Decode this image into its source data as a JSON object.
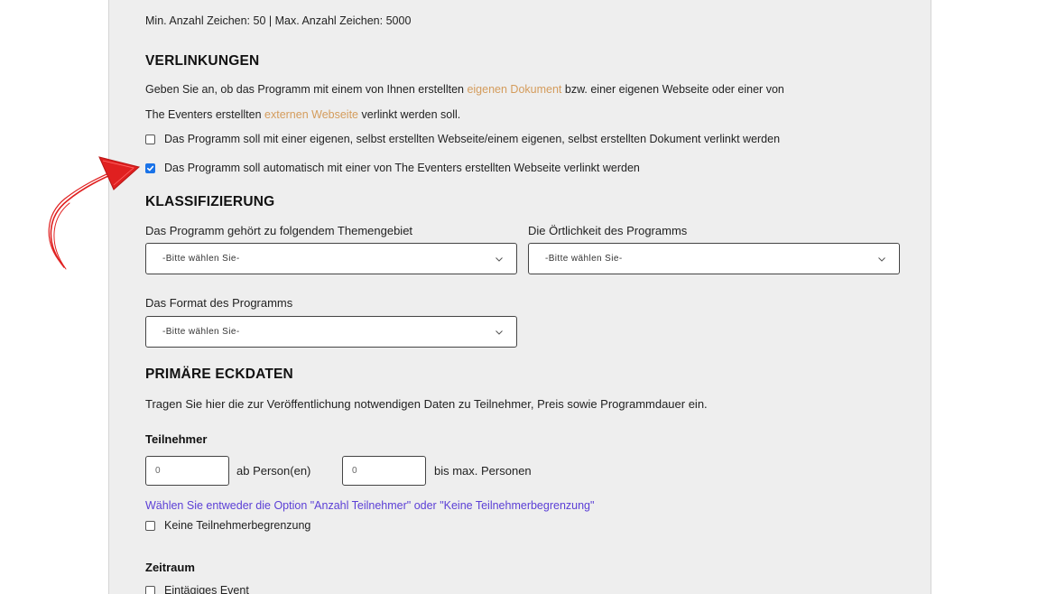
{
  "top_note": "Min. Anzahl Zeichen: 50 | Max. Anzahl Zeichen: 5000",
  "verlinkungen": {
    "title": "VERLINKUNGEN",
    "desc_part1": "Geben Sie an, ob das Programm mit einem von Ihnen erstellten ",
    "desc_link1": "eigenen Dokument",
    "desc_part2": " bzw. einer eigenen Webseite oder einer von",
    "desc_part3": "The Eventers erstellten ",
    "desc_link2": "externen Webseite",
    "desc_part4": " verlinkt werden soll.",
    "option1": "Das Programm soll mit einer eigenen, selbst erstellten Webseite/einem eigenen, selbst erstellten Dokument verlinkt werden",
    "option2": "Das Programm soll automatisch mit einer von The Eventers erstellten Webseite verlinkt werden"
  },
  "klassifizierung": {
    "title": "KLASSIFIZIERUNG",
    "thema_label": "Das Programm gehört zu folgendem Themengebiet",
    "thema_value": "-Bitte wählen Sie-",
    "ort_label": "Die Örtlichkeit des Programms",
    "ort_value": "-Bitte wählen Sie-",
    "format_label": "Das Format des Programms",
    "format_value": "-Bitte wählen Sie-"
  },
  "eckdaten": {
    "title": "PRIMÄRE ECKDATEN",
    "desc": "Tragen Sie hier die zur Veröffentlichung notwendigen Daten zu Teilnehmer, Preis sowie Programmdauer ein.",
    "teilnehmer_label": "Teilnehmer",
    "min_value": "0",
    "min_suffix": "ab Person(en)",
    "max_value": "0",
    "max_suffix": "bis max. Personen",
    "hint": "Wählen Sie entweder die Option \"Anzahl Teilnehmer\" oder \"Keine Teilnehmerbegrenzung\"",
    "no_limit": "Keine Teilnehmerbegrenzung",
    "zeitraum_label": "Zeitraum",
    "eintaegig": "Eintägiges Event"
  },
  "colors": {
    "annotation_arrow": "#e02020",
    "link": "#d49c5c",
    "hint": "#5b3fd6",
    "checkbox_checked": "#1a73e8"
  }
}
